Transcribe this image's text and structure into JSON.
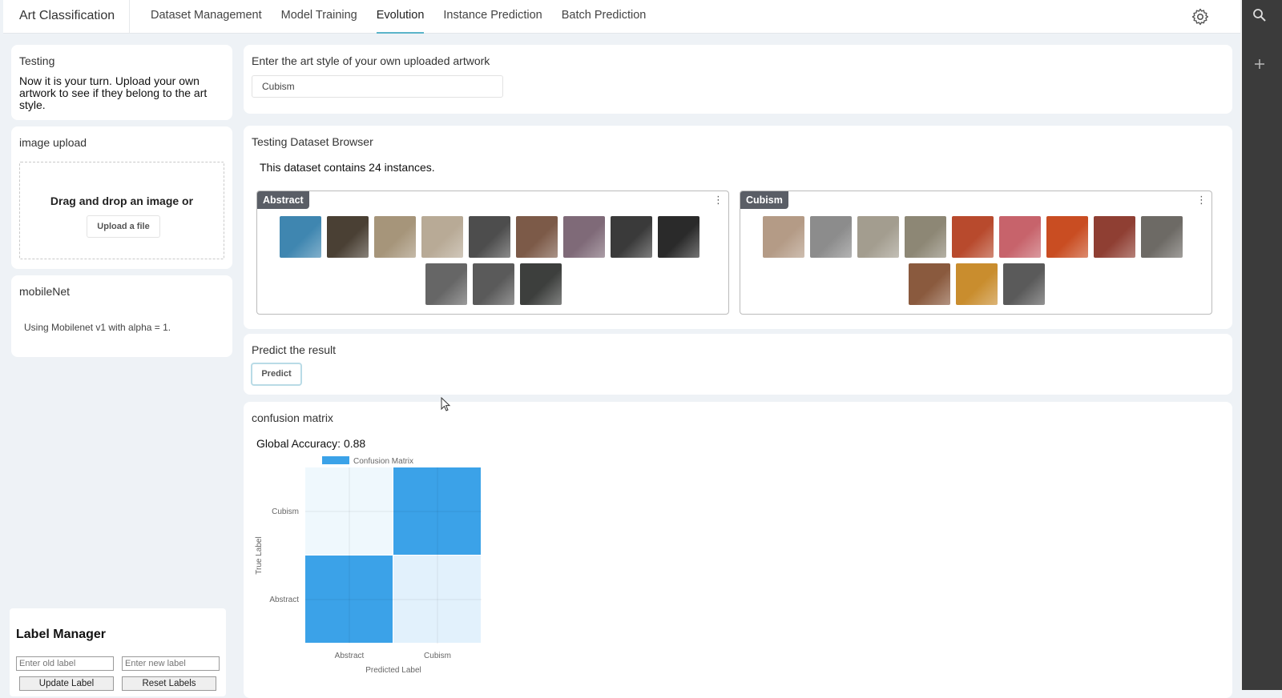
{
  "app": {
    "brand": "Art Classification"
  },
  "nav": {
    "items": [
      {
        "label": "Dataset Management",
        "active": false
      },
      {
        "label": "Model Training",
        "active": false
      },
      {
        "label": "Evolution",
        "active": true
      },
      {
        "label": "Instance Prediction",
        "active": false
      },
      {
        "label": "Batch Prediction",
        "active": false
      }
    ],
    "settings_icon": "gear-icon"
  },
  "testing": {
    "title": "Testing",
    "text": "Now it is your turn. Upload your own artwork to see if they belong to the art style."
  },
  "upload": {
    "title": "image upload",
    "drop_text": "Drag and drop an image or",
    "button": "Upload a file"
  },
  "model": {
    "title": "mobileNet",
    "text": "Using Mobilenet v1 with alpha = 1."
  },
  "style": {
    "title": "Enter the art style of your own uploaded artwork",
    "value": "Cubism"
  },
  "browser": {
    "title": "Testing Dataset Browser",
    "count_text": "This dataset contains 24 instances.",
    "classes": [
      {
        "name": "Abstract",
        "thumb_colors": [
          "#3f86b0",
          "#4a4034",
          "#a6957a",
          "#b8aa96",
          "#4d4d4d",
          "#7c5a48",
          "#7f6a78",
          "#3a3a3a",
          "#2a2a2a",
          "#666666",
          "#5a5a5a",
          "#3d3f3d"
        ]
      },
      {
        "name": "Cubism",
        "thumb_colors": [
          "#b49b86",
          "#8c8c8c",
          "#a39d8f",
          "#8d8775",
          "#b84a2d",
          "#c7636b",
          "#c94d22",
          "#8f3f33",
          "#6d6a65",
          "#8a5a3e",
          "#c98d2e",
          "#5a5a5a"
        ]
      }
    ]
  },
  "predict": {
    "title": "Predict the result",
    "button": "Predict"
  },
  "confusion": {
    "title": "confusion matrix",
    "accuracy_text": "Global Accuracy: 0.88"
  },
  "chart_data": {
    "type": "heatmap",
    "legend": "Confusion Matrix",
    "xlabel": "Predicted Label",
    "ylabel": "True Label",
    "x_categories": [
      "Abstract",
      "Cubism"
    ],
    "y_categories": [
      "Cubism",
      "Abstract"
    ],
    "cells": [
      {
        "true": "Cubism",
        "predicted": "Abstract",
        "intensity": 0.08
      },
      {
        "true": "Cubism",
        "predicted": "Cubism",
        "intensity": 1.0
      },
      {
        "true": "Abstract",
        "predicted": "Abstract",
        "intensity": 1.0
      },
      {
        "true": "Abstract",
        "predicted": "Cubism",
        "intensity": 0.15
      }
    ],
    "color": "#3ba2e8"
  },
  "label_manager": {
    "title": "Label Manager",
    "old_placeholder": "Enter old label",
    "new_placeholder": "Enter new label",
    "update_button": "Update Label",
    "reset_button": "Reset Labels"
  }
}
